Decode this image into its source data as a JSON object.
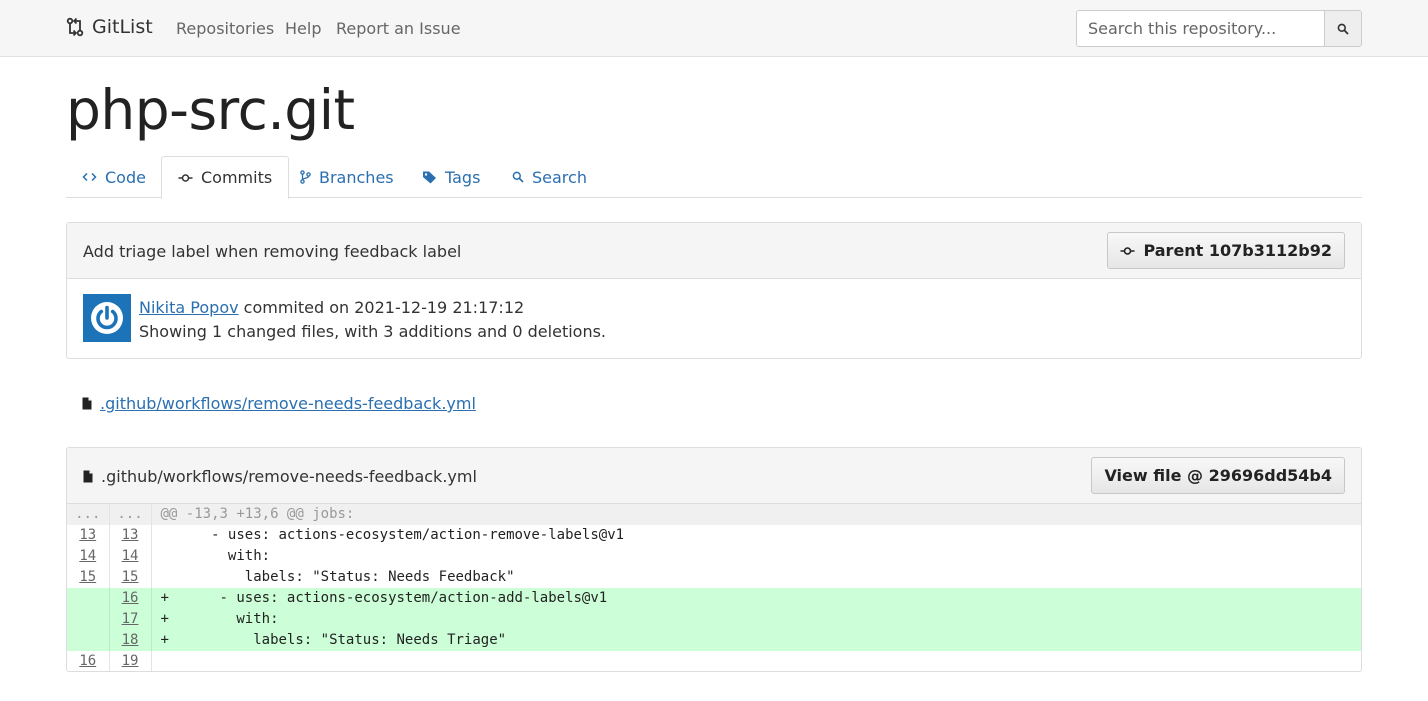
{
  "navbar": {
    "brand": "GitList",
    "links": [
      "Repositories",
      "Help",
      "Report an Issue"
    ],
    "search_placeholder": "Search this repository..."
  },
  "repo": {
    "title": "php-src.git"
  },
  "tabs": [
    {
      "label": "Code",
      "icon": "code-icon"
    },
    {
      "label": "Commits",
      "icon": "commit-icon",
      "active": true
    },
    {
      "label": "Branches",
      "icon": "branch-icon"
    },
    {
      "label": "Tags",
      "icon": "tag-icon"
    },
    {
      "label": "Search",
      "icon": "search-icon"
    }
  ],
  "commit": {
    "message": "Add triage label when removing feedback label",
    "parent_label": "Parent 107b3112b92",
    "author": "Nikita Popov",
    "committed_text": "commited on 2021-12-19 21:17:12",
    "summary": "Showing 1 changed files, with 3 additions and 0 deletions."
  },
  "files": [
    ".github/workflows/remove-needs-feedback.yml"
  ],
  "diff": {
    "path": ".github/workflows/remove-needs-feedback.yml",
    "view_file_label": "View file @ 29696dd54b4",
    "hunk": {
      "old": "...",
      "new": "...",
      "text": "@@ -13,3 +13,6 @@ jobs:"
    },
    "lines": [
      {
        "old": "13",
        "new": "13",
        "text": "      - uses: actions-ecosystem/action-remove-labels@v1",
        "type": "context"
      },
      {
        "old": "14",
        "new": "14",
        "text": "        with:",
        "type": "context"
      },
      {
        "old": "15",
        "new": "15",
        "text": "          labels: \"Status: Needs Feedback\"",
        "type": "context"
      },
      {
        "old": "",
        "new": "16",
        "text": "+      - uses: actions-ecosystem/action-add-labels@v1",
        "type": "add"
      },
      {
        "old": "",
        "new": "17",
        "text": "+        with:",
        "type": "add"
      },
      {
        "old": "",
        "new": "18",
        "text": "+          labels: \"Status: Needs Triage\"",
        "type": "add"
      },
      {
        "old": "16",
        "new": "19",
        "text": "",
        "type": "context"
      }
    ]
  }
}
